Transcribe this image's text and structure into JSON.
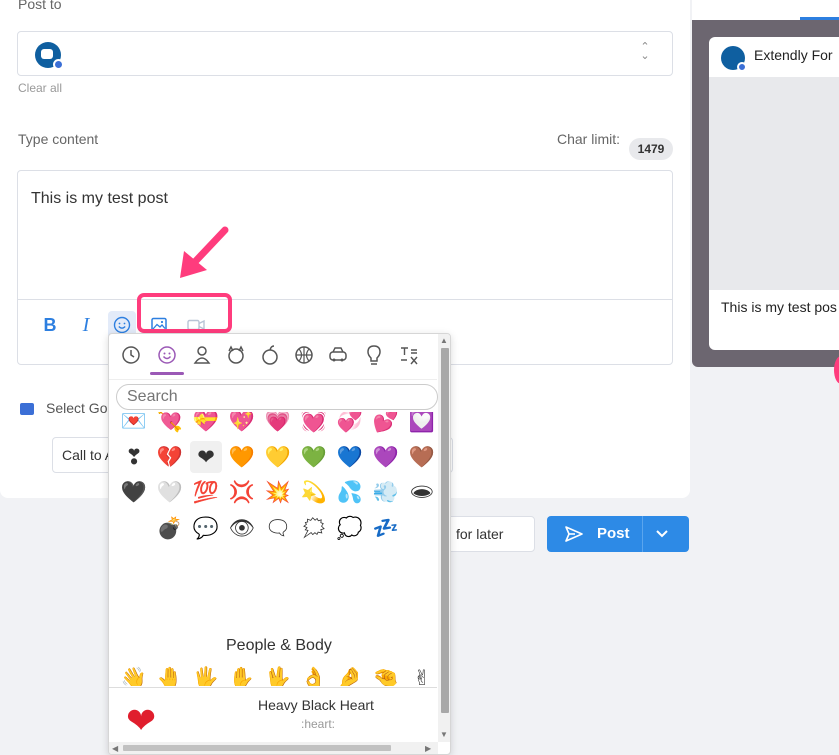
{
  "form": {
    "post_to_label": "Post to",
    "clear_all": "Clear all",
    "type_content_label": "Type content",
    "char_limit_label": "Char limit:",
    "char_limit_value": "1479",
    "content_text": "This is my test post",
    "select_go_label": "Select Go",
    "cta_value": "Call to A"
  },
  "toolbar": {
    "bold": "B",
    "italic": "I",
    "emoji_icon": "smiley-icon",
    "image_icon": "image-icon",
    "video_icon": "video-icon"
  },
  "actions": {
    "later_label": "for later",
    "post_label": "Post"
  },
  "preview": {
    "account_name": "Extendly For",
    "post_text": "This is my test pos"
  },
  "emoji_picker": {
    "categories": [
      "recent-icon",
      "smileys-icon",
      "people-icon",
      "animals-icon",
      "food-icon",
      "activity-icon",
      "travel-icon",
      "objects-icon",
      "symbols-icon"
    ],
    "search_placeholder": "Search",
    "symbols_rows": [
      [
        "💌",
        "💘",
        "💝",
        "💖",
        "💗",
        "💓",
        "💞",
        "💕",
        "💟"
      ],
      [
        "❣",
        "💔",
        "❤",
        "🧡",
        "💛",
        "💚",
        "💙",
        "💜",
        "🤎"
      ],
      [
        "🖤",
        "🤍",
        "💯",
        "💢",
        "💥",
        "💫",
        "💦",
        "💨",
        "🕳"
      ],
      [
        "💣",
        "💬",
        "👁",
        "🗨",
        "🗯",
        "💭",
        "💤"
      ]
    ],
    "section_title": "People & Body",
    "people_rows": [
      [
        "👋",
        "🤚",
        "🖐",
        "✋",
        "🖖",
        "👌",
        "🤌",
        "🤏",
        "✌"
      ],
      [
        "🤞",
        "🤟",
        "🤘",
        "🤙",
        "👈",
        "👉",
        "👆",
        "🖕",
        "👇"
      ],
      [
        "☝",
        "👍",
        "👎",
        "✊",
        "👊",
        "🤛",
        "🤜",
        "👏",
        "🙌"
      ]
    ],
    "selected_emoji": "❤",
    "selected_name": "Heavy Black Heart",
    "selected_code": ":heart:"
  },
  "colors": {
    "accent": "#2d8ae6",
    "annotation": "#ff3c7d",
    "picker_accent": "#9b59b6"
  }
}
